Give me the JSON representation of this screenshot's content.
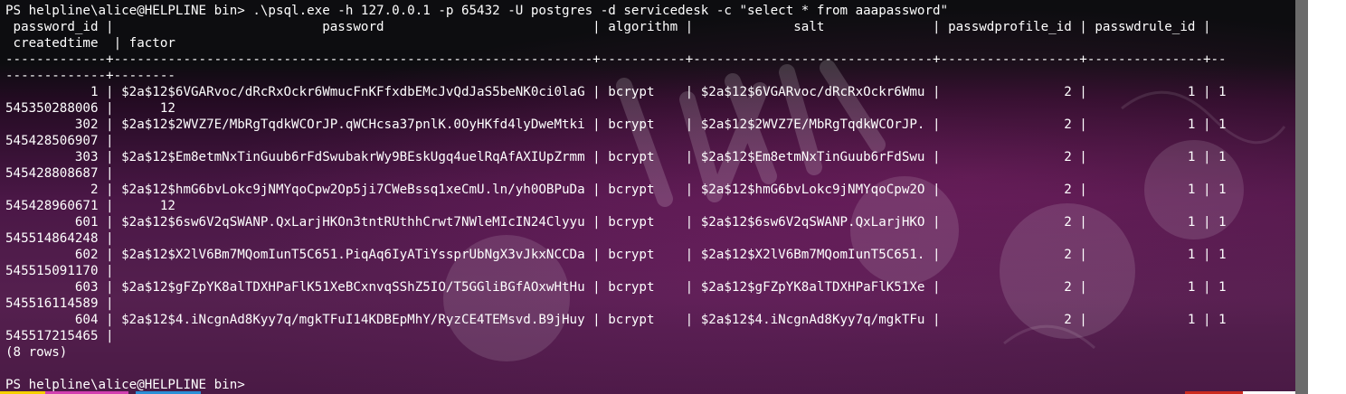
{
  "terminal": {
    "lines": [
      "PS helpline\\alice@HELPLINE bin> .\\psql.exe -h 127.0.0.1 -p 65432 -U postgres -d servicedesk -c \"select * from aaapassword\"",
      " password_id |                           password                           | algorithm |             salt              | passwdprofile_id | passwdrule_id |",
      " createdtime  | factor",
      "-------------+--------------------------------------------------------------+-----------+-------------------------------+------------------+---------------+--",
      "-------------+--------",
      "           1 | $2a$12$6VGARvoc/dRcRxOckr6WmucFnKFfxdbEMcJvQdJaS5beNK0ci0laG | bcrypt    | $2a$12$6VGARvoc/dRcRxOckr6Wmu |                2 |             1 | 1",
      "545350288006 |      12",
      "         302 | $2a$12$2WVZ7E/MbRgTqdkWCOrJP.qWCHcsa37pnlK.0OyHKfd4lyDweMtki | bcrypt    | $2a$12$2WVZ7E/MbRgTqdkWCOrJP. |                2 |             1 | 1",
      "545428506907 |",
      "         303 | $2a$12$Em8etmNxTinGuub6rFdSwubakrWy9BEskUgq4uelRqAfAXIUpZrmm | bcrypt    | $2a$12$Em8etmNxTinGuub6rFdSwu |                2 |             1 | 1",
      "545428808687 |",
      "           2 | $2a$12$hmG6bvLokc9jNMYqoCpw2Op5ji7CWeBssq1xeCmU.ln/yh0OBPuDa | bcrypt    | $2a$12$hmG6bvLokc9jNMYqoCpw2O |                2 |             1 | 1",
      "545428960671 |      12",
      "         601 | $2a$12$6sw6V2qSWANP.QxLarjHKOn3tntRUthhCrwt7NWleMIcIN24Clyyu | bcrypt    | $2a$12$6sw6V2qSWANP.QxLarjHKO |                2 |             1 | 1",
      "545514864248 |",
      "         602 | $2a$12$X2lV6Bm7MQomIunT5C651.PiqAq6IyATiYssprUbNgX3vJkxNCCDa | bcrypt    | $2a$12$X2lV6Bm7MQomIunT5C651. |                2 |             1 | 1",
      "545515091170 |",
      "         603 | $2a$12$gFZpYK8alTDXHPaFlK51XeBCxnvqSShZ5IO/T5GGliBGfAOxwHtHu | bcrypt    | $2a$12$gFZpYK8alTDXHPaFlK51Xe |                2 |             1 | 1",
      "545516114589 |",
      "         604 | $2a$12$4.iNcgnAd8Kyy7q/mgkTFuI14KDBEpMhY/RyzCE4TEMsvd.B9jHuy | bcrypt    | $2a$12$4.iNcgnAd8Kyy7q/mgkTFu |                2 |             1 | 1",
      "545517215465 |",
      "(8 rows)",
      "",
      "PS helpline\\alice@HELPLINE bin>"
    ]
  },
  "colors": {
    "foreground": "#ffffff",
    "background_top": "#0d0d10",
    "background_wallpaper": "#4a1746",
    "scrollbar_thumb": "#6b6b6b",
    "taskbar_strip": [
      "#f5d000",
      "#d13fb0",
      "#2a8fd6",
      "#cc2a1e",
      "#ffffff"
    ]
  }
}
